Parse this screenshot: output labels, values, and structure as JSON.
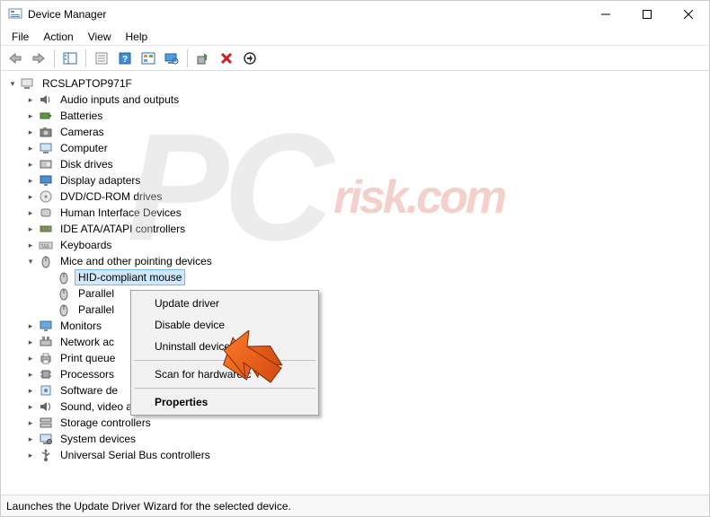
{
  "window": {
    "title": "Device Manager"
  },
  "menubar": {
    "items": [
      "File",
      "Action",
      "View",
      "Help"
    ]
  },
  "toolbar": {
    "back": "Back",
    "forward": "Forward",
    "show_hide_tree": "Show/Hide console tree",
    "properties": "Properties",
    "help": "Help",
    "action_center": "Action Center",
    "scan": "Scan for hardware changes",
    "update_driver": "Update driver",
    "uninstall": "Uninstall device",
    "manage": "Manage"
  },
  "tree": {
    "root": {
      "label": "RCSLAPTOP971F",
      "expanded": true
    },
    "categories": [
      {
        "label": "Audio inputs and outputs",
        "icon": "speaker"
      },
      {
        "label": "Batteries",
        "icon": "battery"
      },
      {
        "label": "Cameras",
        "icon": "camera"
      },
      {
        "label": "Computer",
        "icon": "computer"
      },
      {
        "label": "Disk drives",
        "icon": "disk"
      },
      {
        "label": "Display adapters",
        "icon": "display"
      },
      {
        "label": "DVD/CD-ROM drives",
        "icon": "optical"
      },
      {
        "label": "Human Interface Devices",
        "icon": "hid"
      },
      {
        "label": "IDE ATA/ATAPI controllers",
        "icon": "ide"
      },
      {
        "label": "Keyboards",
        "icon": "keyboard"
      },
      {
        "label": "Mice and other pointing devices",
        "icon": "mouse",
        "expanded": true,
        "children": [
          {
            "label": "HID-compliant mouse",
            "icon": "mouse",
            "selected": true
          },
          {
            "label": "Parallel",
            "icon": "mouse"
          },
          {
            "label": "Parallel",
            "icon": "mouse"
          }
        ]
      },
      {
        "label": "Monitors",
        "icon": "monitor"
      },
      {
        "label": "Network adapters",
        "icon": "network",
        "truncated": "Network ac"
      },
      {
        "label": "Print queues",
        "icon": "printer",
        "truncated": "Print queue"
      },
      {
        "label": "Processors",
        "icon": "cpu"
      },
      {
        "label": "Software devices",
        "icon": "software",
        "truncated": "Software de"
      },
      {
        "label": "Sound, video and game controllers",
        "icon": "sound"
      },
      {
        "label": "Storage controllers",
        "icon": "storage"
      },
      {
        "label": "System devices",
        "icon": "system"
      },
      {
        "label": "Universal Serial Bus controllers",
        "icon": "usb"
      }
    ]
  },
  "context_menu": {
    "update_driver": "Update driver",
    "disable_device": "Disable device",
    "uninstall_device": "Uninstall device",
    "scan_hardware": "Scan for hardware changes",
    "scan_hardware_truncated": "Scan for hardware c",
    "properties": "Properties"
  },
  "statusbar": {
    "text": "Launches the Update Driver Wizard for the selected device."
  },
  "watermark": {
    "main": "PC",
    "domain": "risk.com"
  }
}
